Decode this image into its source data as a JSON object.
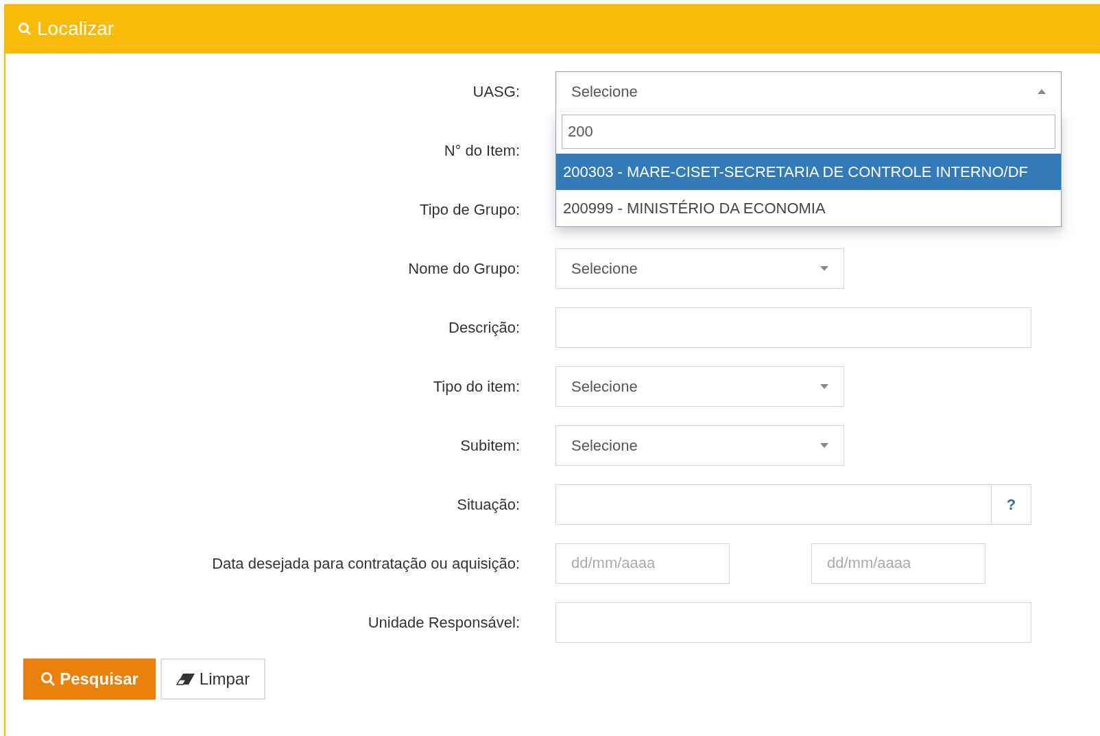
{
  "panel": {
    "title": "Localizar"
  },
  "fields": [
    {
      "label": "UASG:",
      "kind": "select",
      "value": "Selecione",
      "expanded": true,
      "search": "200",
      "options": [
        {
          "text": "200303 - MARE-CISET-SECRETARIA DE CONTROLE INTERNO/DF",
          "selected": true
        },
        {
          "text": "200999 - MINISTÉRIO DA ECONOMIA",
          "selected": false
        }
      ]
    },
    {
      "label": "N° do Item:",
      "kind": "hidden"
    },
    {
      "label": "Tipo de Grupo:",
      "kind": "hidden"
    },
    {
      "label": "Nome do Grupo:",
      "kind": "select",
      "value": "Selecione",
      "expanded": false
    },
    {
      "label": "Descrição:",
      "kind": "text"
    },
    {
      "label": "Tipo do item:",
      "kind": "select",
      "value": "Selecione",
      "expanded": false
    },
    {
      "label": "Subitem:",
      "kind": "select",
      "value": "Selecione",
      "expanded": false
    },
    {
      "label": "Situação:",
      "kind": "help",
      "button": "?"
    },
    {
      "label": "Data desejada para contratação ou aquisição:",
      "kind": "daterange",
      "placeholders": [
        "dd/mm/aaaa",
        "dd/mm/aaaa"
      ]
    },
    {
      "label": "Unidade Responsável:",
      "kind": "text"
    }
  ],
  "buttons": [
    {
      "label": "Pesquisar",
      "kind": "primary"
    },
    {
      "label": "Limpar",
      "kind": "secondary"
    }
  ]
}
